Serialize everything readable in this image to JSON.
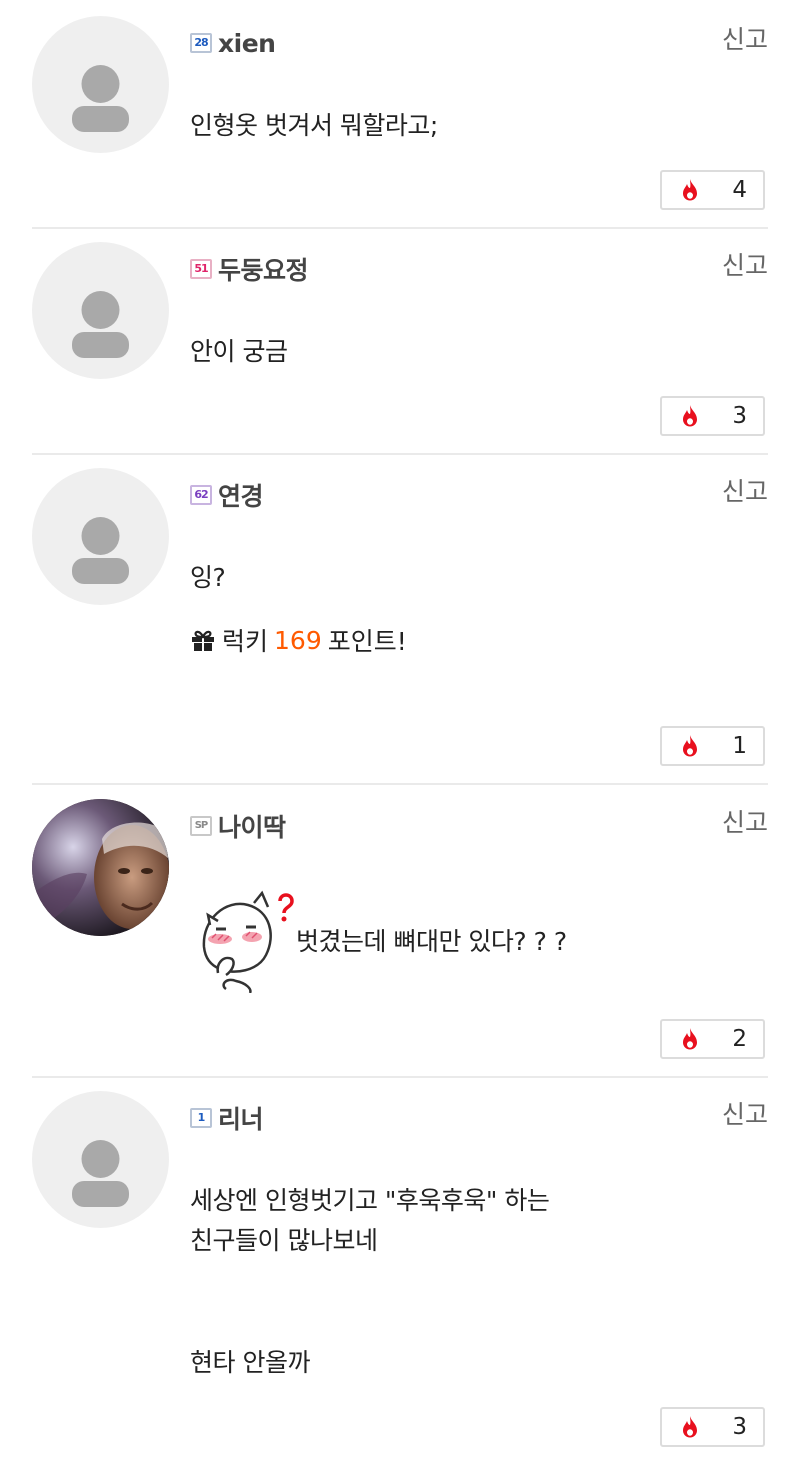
{
  "report_label": "신고",
  "lucky": {
    "prefix": "럭키",
    "points": "169",
    "suffix": "포인트!"
  },
  "comments": [
    {
      "level": "28",
      "nickname": "xien",
      "text": "인형옷 벗겨서 뭐할라고;",
      "likes": "4"
    },
    {
      "level": "51",
      "nickname": "두둥요정",
      "text": "안이 궁금",
      "likes": "3"
    },
    {
      "level": "62",
      "nickname": "연경",
      "text": "잉?",
      "likes": "1"
    },
    {
      "level": "SP",
      "nickname": "나이딱",
      "text": "벗겼는데 뼈대만 있다? ? ?",
      "likes": "2"
    },
    {
      "level": "1",
      "nickname": "리너",
      "text_line1": "세상엔 인형벗기고 \"후욱후욱\" 하는",
      "text_line2": "친구들이 많나보네",
      "text_line3": "현타 안올까",
      "likes": "3"
    }
  ],
  "colors": {
    "accent": "#ff5a00",
    "fire": "#e8101e",
    "divider": "#eaeaea"
  }
}
